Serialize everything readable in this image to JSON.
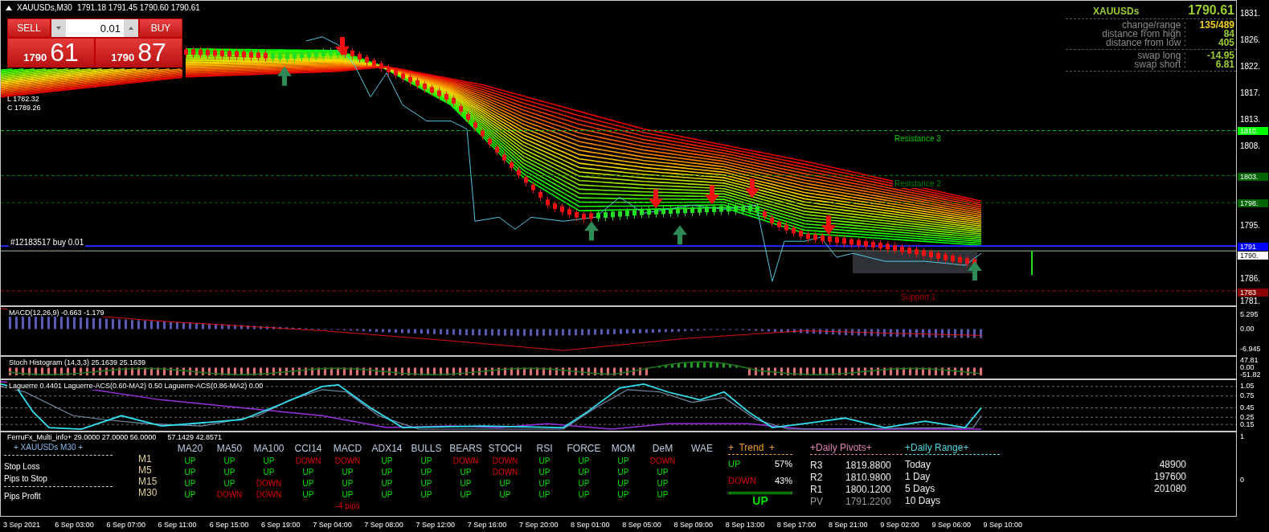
{
  "chart_header": {
    "symbol": "XAUUSDs,M30",
    "ohlc": "1791.18 1791.45 1790.60 1790.61"
  },
  "trade_panel": {
    "sell_label": "SELL",
    "buy_label": "BUY",
    "lot": "0.01",
    "sell_price": {
      "prefix": "1790",
      "big": "61"
    },
    "buy_price": {
      "prefix": "1790",
      "big": "87"
    }
  },
  "yesterday_levels": [
    "L 1782.32",
    "C 1789.26"
  ],
  "level_lines": [
    {
      "label": "Resistance 3",
      "kind": "resistance",
      "color": "#00c800"
    },
    {
      "label": "Resistance 2",
      "kind": "resistance",
      "color": "#008000"
    },
    {
      "label": "Support 1",
      "kind": "support",
      "color": "#b00000"
    },
    {
      "label": "#12183517 buy 0.01",
      "kind": "order",
      "color": "#2828ff"
    }
  ],
  "symbol_info": {
    "symbol": "XAUUSDs",
    "price": "1790.61",
    "groups": [
      [
        {
          "label": "change/range :",
          "value": "135/489",
          "kind": "highlight"
        },
        {
          "label": "distance from high :",
          "value": "84",
          "kind": "normal"
        },
        {
          "label": "distance from low :",
          "value": "405",
          "kind": "normal"
        }
      ],
      [
        {
          "label": "swap long :",
          "value": "-14.95",
          "kind": "normal"
        },
        {
          "label": "swap short :",
          "value": "6.81",
          "kind": "normal"
        }
      ]
    ]
  },
  "price_axis": {
    "ticks": [
      "1831.",
      "1826.",
      "1822.",
      "1817.",
      "1813.",
      "1808.",
      "1795.",
      "1786.",
      "1781."
    ],
    "tags": [
      {
        "label": "1810.",
        "color": "#00ff00"
      },
      {
        "label": "1803.",
        "color": "#006400"
      },
      {
        "label": "1798.",
        "color": "#006400"
      },
      {
        "label": "1791",
        "color": "#0000ff"
      },
      {
        "label": "1790.",
        "color": "#ffffff"
      },
      {
        "label": "1783",
        "color": "#8b0000"
      }
    ]
  },
  "subwindows": [
    {
      "kind": "macd",
      "title": "MACD(12,26,9) -0.663 -1.179",
      "axis": [
        "5.295",
        "0.00",
        "-6.945"
      ]
    },
    {
      "kind": "stoch",
      "title": "Stoch Histogram (14,3,3) 25.1639 25.1639",
      "axis": [
        "47.81",
        "0.00",
        "-51.82"
      ]
    },
    {
      "kind": "laguerre",
      "title": "Laguerre 0.4401  Laguerre-ACS(0.60-MA2) 0.50  Laguerre-ACS(0.86-MA2) 0.00",
      "axis": [
        "1.05",
        "0.75",
        "0.45",
        "0.25",
        "0.15"
      ]
    }
  ],
  "multi_info": {
    "title": "FerruFx_Multi_info+ 29.0000 27.0000 56.0000",
    "title_extra": "57.1429 42.8571",
    "symbol": "+ XAUUSDs M30 +",
    "side_labels": [
      "Stop Loss",
      "Pips to Stop",
      "Pips Profit"
    ],
    "columns": [
      "MA20",
      "MA50",
      "MA100",
      "CCI14",
      "MACD",
      "ADX14",
      "BULLS",
      "BEARS",
      "STOCH",
      "RSI",
      "FORCE",
      "MOM",
      "DeM",
      "WAE"
    ],
    "rows": [
      {
        "timeframe": "M1",
        "signals": [
          {
            "text": "UP",
            "color": "#00e000"
          },
          {
            "text": "UP",
            "color": "#00e000"
          },
          {
            "text": "UP",
            "color": "#00e000"
          },
          {
            "text": "DOWN",
            "color": "#e00000"
          },
          {
            "text": "DOWN",
            "color": "#e00000"
          },
          {
            "text": "UP",
            "color": "#00e000"
          },
          {
            "text": "UP",
            "color": "#00e000"
          },
          {
            "text": "DOWN",
            "color": "#e00000"
          },
          {
            "text": "DOWN",
            "color": "#e00000"
          },
          {
            "text": "UP",
            "color": "#00e000"
          },
          {
            "text": "UP",
            "color": "#00e000"
          },
          {
            "text": "UP",
            "color": "#00e000"
          },
          {
            "text": "DOWN",
            "color": "#e00000"
          }
        ]
      },
      {
        "timeframe": "M5",
        "signals": [
          {
            "text": "UP",
            "color": "#00e000"
          },
          {
            "text": "UP",
            "color": "#00e000"
          },
          {
            "text": "UP",
            "color": "#00e000"
          },
          {
            "text": "UP",
            "color": "#00e000"
          },
          {
            "text": "UP",
            "color": "#00e000"
          },
          {
            "text": "UP",
            "color": "#00e000"
          },
          {
            "text": "UP",
            "color": "#00e000"
          },
          {
            "text": "UP",
            "color": "#00e000"
          },
          {
            "text": "DOWN",
            "color": "#e00000"
          },
          {
            "text": "UP",
            "color": "#00e000"
          },
          {
            "text": "UP",
            "color": "#00e000"
          },
          {
            "text": "UP",
            "color": "#00e000"
          },
          {
            "text": "UP",
            "color": "#00e000"
          }
        ]
      },
      {
        "timeframe": "M15",
        "signals": [
          {
            "text": "UP",
            "color": "#00e000"
          },
          {
            "text": "UP",
            "color": "#00e000"
          },
          {
            "text": "DOWN",
            "color": "#e00000"
          },
          {
            "text": "UP",
            "color": "#00e000"
          },
          {
            "text": "UP",
            "color": "#00e000"
          },
          {
            "text": "UP",
            "color": "#00e000"
          },
          {
            "text": "UP",
            "color": "#00e000"
          },
          {
            "text": "UP",
            "color": "#00e000"
          },
          {
            "text": "UP",
            "color": "#00e000"
          },
          {
            "text": "UP",
            "color": "#00e000"
          },
          {
            "text": "UP",
            "color": "#00e000"
          },
          {
            "text": "UP",
            "color": "#00e000"
          },
          {
            "text": "UP",
            "color": "#00e000"
          }
        ]
      },
      {
        "timeframe": "M30",
        "signals": [
          {
            "text": "UP",
            "color": "#00e000"
          },
          {
            "text": "DOWN",
            "color": "#e00000"
          },
          {
            "text": "DOWN",
            "color": "#e00000"
          },
          {
            "text": "UP",
            "color": "#00e000"
          },
          {
            "text": "UP",
            "color": "#00e000"
          },
          {
            "text": "UP",
            "color": "#00e000"
          },
          {
            "text": "UP",
            "color": "#00e000"
          },
          {
            "text": "UP",
            "color": "#00e000"
          },
          {
            "text": "UP",
            "color": "#00e000"
          },
          {
            "text": "UP",
            "color": "#00e000"
          },
          {
            "text": "UP",
            "color": "#00e000"
          },
          {
            "text": "UP",
            "color": "#00e000"
          },
          {
            "text": "UP",
            "color": "#00e000"
          }
        ]
      }
    ],
    "pips_note": "-4 pips",
    "trend": {
      "title": "+  Trend  +",
      "up_label": "UP",
      "up_value": "57%",
      "down_label": "DOWN",
      "down_value": "43%",
      "signal": {
        "text": "UP",
        "color": "#00e000"
      }
    },
    "pivots": {
      "title": "+Daily Pivots+",
      "rows": [
        {
          "label": "R3",
          "value": "1819.8800",
          "kind": "level"
        },
        {
          "label": "R2",
          "value": "1810.9800",
          "kind": "level"
        },
        {
          "label": "R1",
          "value": "1800.1200",
          "kind": "level"
        },
        {
          "label": "PV",
          "value": "1791.2200",
          "kind": "pivot"
        }
      ]
    },
    "range": {
      "title": "+Daily Range+",
      "rows": [
        {
          "label": "Today",
          "value": "48900"
        },
        {
          "label": "1 Day",
          "value": "197600"
        },
        {
          "label": "5 Days",
          "value": "201080"
        },
        {
          "label": "10 Days"
        }
      ]
    },
    "axis": [
      "1",
      "0"
    ]
  },
  "time_axis": [
    "3 Sep 2021",
    "6 Sep 03:00",
    "6 Sep 07:00",
    "6 Sep 11:00",
    "6 Sep 15:00",
    "6 Sep 19:00",
    "7 Sep 04:00",
    "7 Sep 08:00",
    "7 Sep 12:00",
    "7 Sep 16:00",
    "7 Sep 20:00",
    "8 Sep 01:00",
    "8 Sep 05:00",
    "8 Sep 09:00",
    "8 Sep 13:00",
    "8 Sep 17:00",
    "8 Sep 21:00",
    "9 Sep 02:00",
    "9 Sep 06:00",
    "9 Sep 10:00"
  ]
}
